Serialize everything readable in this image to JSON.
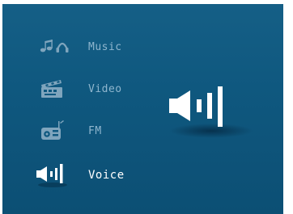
{
  "menu": {
    "items": [
      {
        "label": "Music",
        "icon": "music-icon",
        "selected": false
      },
      {
        "label": "Video",
        "icon": "video-icon",
        "selected": false
      },
      {
        "label": "FM",
        "icon": "radio-icon",
        "selected": false
      },
      {
        "label": "Voice",
        "icon": "voice-icon",
        "selected": true
      }
    ]
  },
  "preview": {
    "icon": "voice-large-icon"
  },
  "colors": {
    "background": "#0f587f",
    "label": "#8fb6ce",
    "selected_label": "#ffffff"
  }
}
